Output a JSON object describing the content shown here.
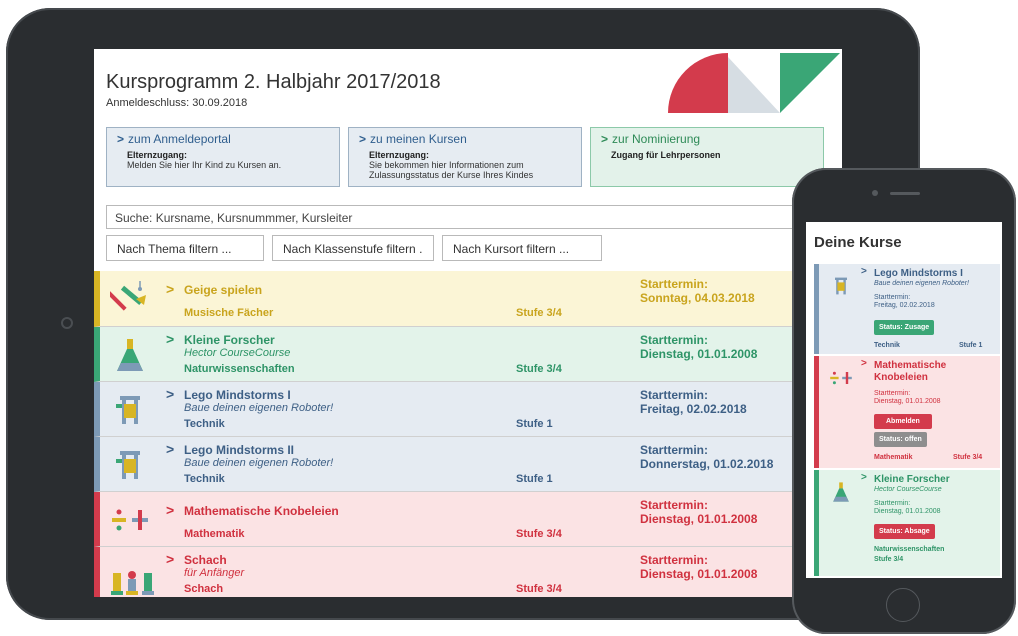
{
  "tablet": {
    "title": "Kursprogramm 2. Halbjahr 2017/2018",
    "subtitle": "Anmeldeschluss: 30.09.2018",
    "nav": [
      {
        "title": "zum Anmeldeportal",
        "bold": "Elternzugang:",
        "text": "Melden Sie hier Ihr Kind zu Kursen an."
      },
      {
        "title": "zu meinen Kursen",
        "bold": "Elternzugang:",
        "text": "Sie bekommen hier Informationen zum Zulassungsstatus der Kurse Ihres Kindes"
      },
      {
        "title": "zur Nominierung",
        "bold": "Zugang für Lehrpersonen",
        "text": ""
      }
    ],
    "search_placeholder": "Suche: Kursname, Kursnummmer, Kursleiter",
    "filters": [
      "Nach Thema filtern ...",
      "Nach Klassenstufe filtern .",
      "Nach Kursort filtern ..."
    ],
    "courses": [
      {
        "name": "Geige spielen",
        "sub": "",
        "category": "Musische Fächer",
        "stufe": "Stufe 3/4",
        "start_label": "Starttermin:",
        "date": "Sonntag, 04.03.2018",
        "color": "yellow",
        "icon": "violin-icon"
      },
      {
        "name": "Kleine Forscher",
        "sub": "Hector CourseCourse",
        "category": "Naturwissenschaften",
        "stufe": "Stufe 3/4",
        "start_label": "Starttermin:",
        "date": "Dienstag, 01.01.2008",
        "color": "green",
        "icon": "flask-icon"
      },
      {
        "name": "Lego Mindstorms I",
        "sub": "Baue deinen eigenen Roboter!",
        "category": "Technik",
        "stufe": "Stufe 1",
        "start_label": "Starttermin:",
        "date": "Freitag, 02.02.2018",
        "color": "blue",
        "icon": "robot-icon"
      },
      {
        "name": "Lego Mindstorms II",
        "sub": "Baue deinen eigenen Roboter!",
        "category": "Technik",
        "stufe": "Stufe 1",
        "start_label": "Starttermin:",
        "date": "Donnerstag, 01.02.2018",
        "color": "blue",
        "icon": "robot-icon"
      },
      {
        "name": "Mathematische Knobeleien",
        "sub": "",
        "category": "Mathematik",
        "stufe": "Stufe 3/4",
        "start_label": "Starttermin:",
        "date": "Dienstag, 01.01.2008",
        "color": "red",
        "icon": "math-symbols-icon"
      },
      {
        "name": "Schach",
        "sub": "für Anfänger",
        "category": "Schach",
        "stufe": "Stufe 3/4",
        "start_label": "Starttermin:",
        "date": "Dienstag, 01.01.2008",
        "color": "red",
        "icon": "chess-pieces-icon"
      }
    ]
  },
  "phone": {
    "title": "Deine Kurse",
    "cards": [
      {
        "name": "Lego Mindstorms I",
        "sub": "Baue deinen eigenen Roboter!",
        "start_label": "Starttermin:",
        "date": "Freitag, 02.02.2018",
        "badges": [
          "Status: Zusage"
        ],
        "category": "Technik",
        "stufe": "Stufe 1"
      },
      {
        "name_line1": "Mathematische",
        "name_line2": "Knobeleien",
        "start_label": "Starttermin:",
        "date": "Dienstag, 01.01.2008",
        "badges": [
          "Abmelden",
          "Status: offen"
        ],
        "category": "Mathematik",
        "stufe": "Stufe 3/4"
      },
      {
        "name": "Kleine Forscher",
        "sub": "Hector CourseCourse",
        "start_label": "Starttermin:",
        "date": "Dienstag, 01.01.2008",
        "badges": [
          "Status: Absage"
        ],
        "category": "Naturwissenschaften",
        "stufe": "Stufe 3/4"
      }
    ]
  },
  "colors": {
    "red": "#d33b4c",
    "green": "#3aa676",
    "blue": "#7d9ab6",
    "yellow": "#d8b524",
    "grey": "#8e8e8e"
  }
}
